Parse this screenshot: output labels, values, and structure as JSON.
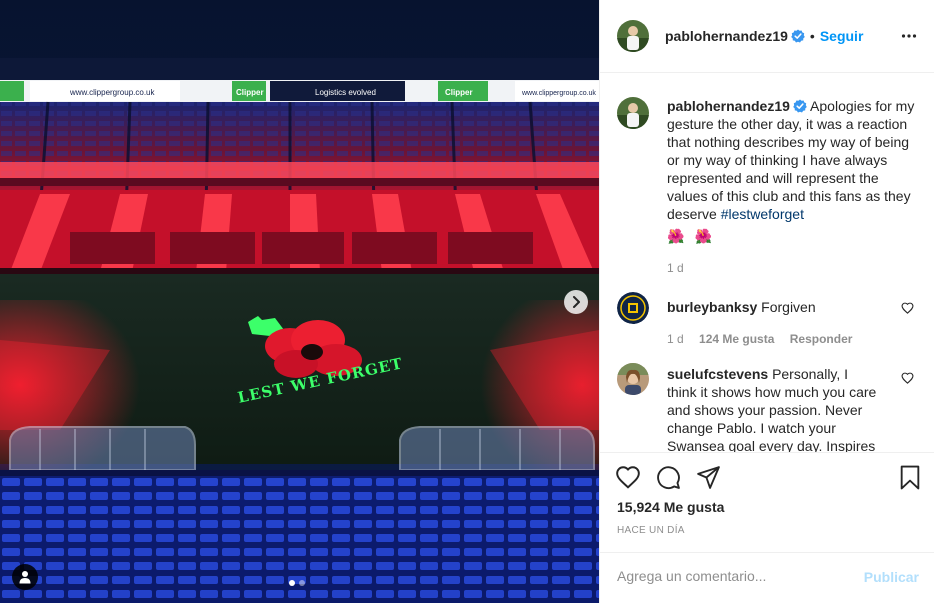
{
  "photo": {
    "banners": [
      "www.clippergroup.co.uk",
      "Clipper",
      "Logistics evolved",
      "Clipper",
      "www.clippergroup.co.uk"
    ],
    "pitch_text": "LEST WE FORGET",
    "next_icon": "chevron-right-icon",
    "tag_icon": "user-tag-icon",
    "slide_count": 2,
    "active_slide": 1
  },
  "post": {
    "username": "pablohernandez19",
    "verified_icon": "verified-badge-icon",
    "separator": "•",
    "follow_label": "Seguir",
    "more_icon": "more-options-icon",
    "caption": {
      "username": "pablohernandez19",
      "text": "Apologies for my gesture the other day, it was a reaction that nothing describes my way of being or my way of thinking I have always represented and will represent the values of this club and this fans as they deserve ",
      "hashtag": "#lestweforget",
      "emoji": [
        "🌺",
        "🌺"
      ],
      "time": "1 d"
    },
    "comments": [
      {
        "username": "burleybanksy",
        "text": "Forgiven",
        "time": "1 d",
        "likes": "124 Me gusta",
        "reply": "Responder"
      },
      {
        "username": "suelufcstevens",
        "text": "Personally, I think it shows how much you care and shows your passion. Never change Pablo. I watch your Swansea goal every day. Inspires"
      }
    ],
    "likes_count": "15,924 Me gusta",
    "posted": "HACE UN DÍA",
    "comment_placeholder": "Agrega un comentario...",
    "publish_label": "Publicar"
  },
  "colors": {
    "accent": "#0095f6",
    "publish_disabled": "#b2dffc",
    "hashtag": "#00376b",
    "muted": "#8e8e8e",
    "stand_red": "#ff2a3a",
    "seat_blue": "#1f3dbf",
    "pitch_green": "#152a1c",
    "poppy_green": "#3cff6a"
  }
}
